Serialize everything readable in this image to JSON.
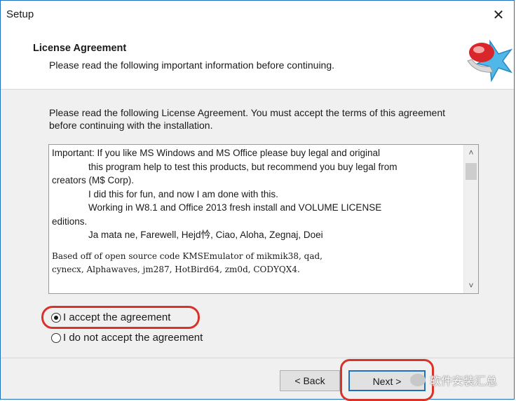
{
  "window": {
    "title": "Setup",
    "close_glyph": "✕"
  },
  "header": {
    "title": "License Agreement",
    "subtitle": "Please read the following important information before continuing.",
    "icon": "setup-logo-icon"
  },
  "intro_text": "Please read the following License Agreement. You must accept the terms of this agreement before continuing with the installation.",
  "license": {
    "lines": [
      "Important: If you like MS Windows and MS Office please buy legal and original",
      "this program help to test this products, but recommend you buy legal from",
      "creators (M$ Corp).",
      "I did this for fun, and now I am done with this.",
      "Working in W8.1 and Office 2013 fresh install and VOLUME LICENSE",
      "editions.",
      "Ja mata ne, Farewell, Hejd忴, Ciao, Aloha, Zegnaj, Doei",
      "Based off of open source code KMSEmulator of mikmik38, qad,",
      "cynecx, Alphawaves, jm287, HotBird64, zm0d, CODYQX4."
    ]
  },
  "scrollbar": {
    "up": "˄",
    "down": "˅"
  },
  "options": {
    "accept": "I accept the agreement",
    "decline": "I do not accept the agreement",
    "selected": "accept"
  },
  "buttons": {
    "back": "< Back",
    "next": "Next >"
  },
  "watermark": {
    "text": "软件安装汇总"
  },
  "colors": {
    "highlight": "#d9322a",
    "accent": "#1f6fbf"
  }
}
